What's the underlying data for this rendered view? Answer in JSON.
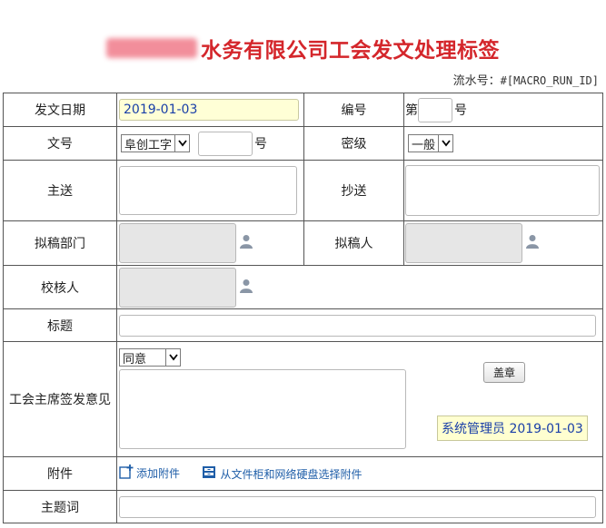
{
  "header": {
    "title": "水务有限公司工会发文处理标签",
    "serial_label": "流水号：",
    "serial_value": "#[MACRO_RUN_ID]"
  },
  "form": {
    "date": {
      "label": "发文日期",
      "value": "2019-01-03"
    },
    "number": {
      "label": "编号",
      "prefix": "第",
      "suffix": "号",
      "value": ""
    },
    "doc_no": {
      "label": "文号",
      "prefix_selected": "阜创工字",
      "value": "",
      "suffix": "号"
    },
    "secret": {
      "label": "密级",
      "selected": "一般"
    },
    "main_send": {
      "label": "主送",
      "value": ""
    },
    "copy_send": {
      "label": "抄送",
      "value": ""
    },
    "draft_dept": {
      "label": "拟稿部门",
      "value": ""
    },
    "drafter": {
      "label": "拟稿人",
      "value": ""
    },
    "checker": {
      "label": "校核人",
      "value": ""
    },
    "subject": {
      "label": "标题",
      "value": ""
    },
    "chairman_opinion": {
      "label": "工会主席签发意见",
      "selected": "同意",
      "value": "",
      "stamp_button": "盖章",
      "signer": "系统管理员 2019-01-03"
    },
    "attachment": {
      "label": "附件",
      "add_link": "添加附件",
      "select_link": "从文件柜和网络硬盘选择附件"
    },
    "keywords": {
      "label": "主题词",
      "value": ""
    }
  },
  "colors": {
    "title": "#d4262b",
    "date_bg": "#ffffd6",
    "link": "#1f5ea8",
    "readonly_bg": "#e6e6e6"
  },
  "icons": [
    "person-icon",
    "chevron-down-icon",
    "add-attachment-icon",
    "file-cabinet-icon"
  ]
}
